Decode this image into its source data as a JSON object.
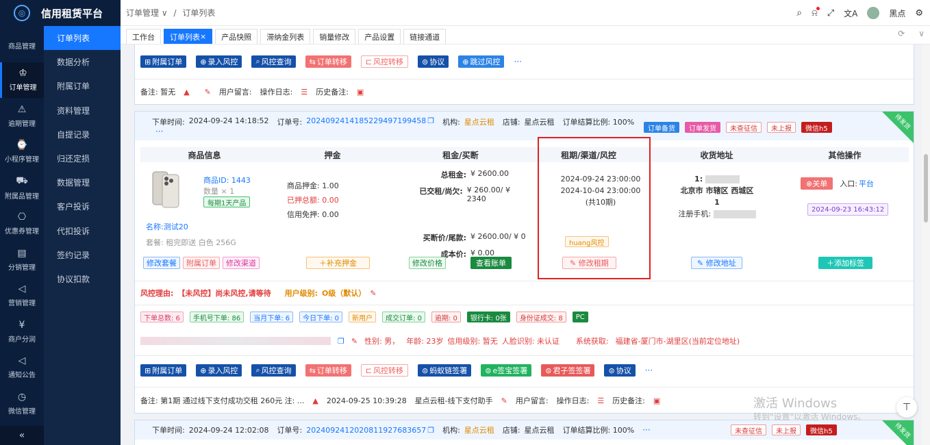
{
  "app": {
    "title": "信用租赁平台"
  },
  "sidebar1": [
    {
      "label": "商品管理",
      "icon": "apple-icon",
      "glyph": ""
    },
    {
      "label": "订单管理",
      "icon": "trophy-icon",
      "glyph": "♔"
    },
    {
      "label": "逾期管理",
      "icon": "bell-icon",
      "glyph": "⚠"
    },
    {
      "label": "小程序管理",
      "icon": "watch-icon",
      "glyph": "⌚"
    },
    {
      "label": "附属品管理",
      "icon": "cart-icon",
      "glyph": "⛟"
    },
    {
      "label": "优惠券管理",
      "icon": "gift-icon",
      "glyph": "⎔"
    },
    {
      "label": "分销管理",
      "icon": "chart-icon",
      "glyph": "▤"
    },
    {
      "label": "营销管理",
      "icon": "megaphone-icon",
      "glyph": "◁"
    },
    {
      "label": "商户分润",
      "icon": "yen-icon",
      "glyph": "¥"
    },
    {
      "label": "通知公告",
      "icon": "notice-icon",
      "glyph": "◁"
    },
    {
      "label": "微信管理",
      "icon": "clock-icon",
      "glyph": "◷"
    }
  ],
  "collapse_glyph": "«",
  "sidebar2": [
    "订单列表",
    "数据分析",
    "附属订单",
    "资料管理",
    "自提记录",
    "归还定损",
    "数据管理",
    "客户投诉",
    "代扣投诉",
    "签约记录",
    "协议扣款"
  ],
  "breadcrumb": {
    "parent": "订单管理 ∨",
    "sep": "/",
    "current": "订单列表"
  },
  "user": {
    "name": "黑点"
  },
  "tabs": [
    "工作台",
    "订单列表",
    "产品快照",
    "滞纳金列表",
    "销量修改",
    "产品设置",
    "链接通道"
  ],
  "top_actions": [
    "附属订单",
    "录入风控",
    "风控查询",
    "订单转移",
    "风控转移",
    "协议",
    "跳过风控"
  ],
  "top_note": {
    "remark": "备注: 暂无",
    "leave_msg": "用户留言:",
    "op_log": "操作日志:",
    "history": "历史备注:"
  },
  "order1": {
    "time_label": "下单时间:",
    "time": "2024-09-24 14:18:52",
    "no_label": "订单号:",
    "no": "20240924141852294971994​58",
    "org_label": "机构:",
    "org": "星点云租",
    "shop_label": "店铺:",
    "shop": "星点云租",
    "ratio": "订单结算比例: 100%",
    "tags": [
      "订单备货",
      "订单发货",
      "未查征信",
      "未上报",
      "微信h5"
    ],
    "status_corner": "待发货",
    "headers": [
      "商品信息",
      "押金",
      "租金/买断",
      "租期/渠道/风控",
      "收货地址",
      "其他操作"
    ],
    "product": {
      "id_label": "商品ID:",
      "id": "1443",
      "qty": "数量 × 1",
      "badge": "每期1天产品",
      "name_label": "名称:",
      "name": "测试20",
      "pkg": "套餐: 租完即送 白色 256G"
    },
    "deposit": {
      "a_label": "商品押金:",
      "a": "1.00",
      "b_label": "已押总额:",
      "b": "0.00",
      "c_label": "信用免押:",
      "c": "0.00"
    },
    "rent": {
      "total_label": "总租金:",
      "total": "¥ 2600.00",
      "paid_label": "已交租/尚欠:",
      "paid": "¥ 260.00/ ¥ 2340",
      "buy_label": "买断价/尾款:",
      "buy": "¥ 2600.00/ ¥ 0",
      "cost_label": "成本价:",
      "cost": "¥ 0.00"
    },
    "period": {
      "start": "2024-09-24 23:00:00",
      "end": "2024-10-04 23:00:00",
      "count": "(共10期)",
      "risk": "huang风控"
    },
    "address": {
      "line1": "1:",
      "line2": "北京市 市辖区 西城区",
      "line3": "1",
      "phone_label": "注册手机:"
    },
    "other": {
      "close": "关单",
      "entry": "入口:",
      "platform": "平台",
      "date": "2024-09-23 16:43:12"
    },
    "row_buttons": {
      "modify_pkg": "修改套餐",
      "attach": "附属订单",
      "modify_ch": "修改渠道",
      "add_dep": "补充押金",
      "modify_price": "修改价格",
      "view_bill": "查看账单",
      "modify_term": "修改租期",
      "modify_addr": "修改地址",
      "add_tag": "添加标签"
    },
    "risk": {
      "reason_label": "风控理由:",
      "reason": "【未风控】尚未风控,请等待",
      "level_label": "用户级别:",
      "level": "O级（默认）"
    },
    "stats": [
      "下单总数: 6",
      "手机号下单: 86",
      "当月下单: 6",
      "今日下单: 0",
      "新用户",
      "成交订单: 0",
      "逾期: 0",
      "银行卡: 0张",
      "身份证成交: 8",
      "PC"
    ],
    "user_info": {
      "gender": "性别: 男，",
      "age": "年龄: 23岁",
      "credit": "信用级别: 暂无",
      "face": "人脸识别: 未认证",
      "sys": "系统获取:",
      "loc": "福建省-厦门市-湖里区(当前定位地址)"
    },
    "actions": [
      "附属订单",
      "录入风控",
      "风控查询",
      "订单转移",
      "风控转移",
      "蚂蚁链签署",
      "e签宝签署",
      "君子签签署",
      "协议"
    ],
    "note": {
      "remark": "备注: 第1期 通过线下支付成功交租 260元 注: ...",
      "time": "2024-09-25 10:39:28",
      "by": "星点云租-线下支付助手",
      "leave_msg": "用户留言:",
      "op_log": "操作日志:",
      "history": "历史备注:"
    }
  },
  "order2": {
    "time_label": "下单时间:",
    "time": "2024-09-24 12:02:08",
    "no_label": "订单号:",
    "no": "20240924120208119276836​57",
    "org_label": "机构:",
    "org": "星点云租",
    "shop_label": "店铺:",
    "shop": "星点云租",
    "ratio": "订单结算比例: 100%",
    "tags": [
      "未查征信",
      "未上报",
      "微信h5"
    ],
    "status_corner": "待发货"
  },
  "watermark": {
    "line1": "激活 Windows",
    "line2": "转到\"设置\"以激活 Windows。"
  },
  "colors": {
    "primary": "#1677ff",
    "sidebar": "#0b1f3d",
    "highlight_box": "#e02020"
  }
}
